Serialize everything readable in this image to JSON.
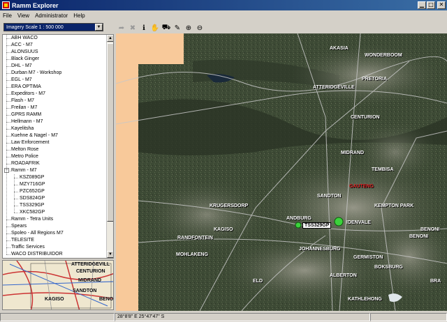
{
  "window": {
    "title": "Ramm Explorer"
  },
  "menu": [
    {
      "label": "File"
    },
    {
      "label": "View"
    },
    {
      "label": "Administrator"
    },
    {
      "label": "Help"
    }
  ],
  "scale_select": {
    "value": "Imagery Scale 1 : 500 000"
  },
  "toolbar": [
    {
      "name": "back-arrow-icon",
      "glyph": "➦",
      "disabled": true
    },
    {
      "name": "delete-icon",
      "glyph": "✖",
      "disabled": true
    },
    {
      "name": "info-icon",
      "glyph": "ℹ",
      "disabled": false
    },
    {
      "name": "pan-hand-icon",
      "glyph": "✋",
      "disabled": false
    },
    {
      "name": "vehicle-locate-icon",
      "glyph": "⛟",
      "disabled": false
    },
    {
      "name": "measure-icon",
      "glyph": "✎",
      "disabled": false
    },
    {
      "name": "zoom-in-icon",
      "glyph": "⊕",
      "disabled": false
    },
    {
      "name": "zoom-out-icon",
      "glyph": "⊖",
      "disabled": false
    }
  ],
  "tree": [
    {
      "label": "ABH WACO",
      "level": 0
    },
    {
      "label": "ACC - M7",
      "level": 0
    },
    {
      "label": "ALONSUUS",
      "level": 0
    },
    {
      "label": "Black Ginger",
      "level": 0
    },
    {
      "label": "DHL - M7",
      "level": 0
    },
    {
      "label": "Durban M7 - Workshop",
      "level": 0
    },
    {
      "label": "EGL - M7",
      "level": 0
    },
    {
      "label": "ERA OPTIMA",
      "level": 0
    },
    {
      "label": "Expeditors - M7",
      "level": 0
    },
    {
      "label": "Flash - M7",
      "level": 0
    },
    {
      "label": "Freilan - M7",
      "level": 0
    },
    {
      "label": "GPRS RAMM",
      "level": 0
    },
    {
      "label": "Hellmann - M7",
      "level": 0
    },
    {
      "label": "Kayelitsha",
      "level": 0
    },
    {
      "label": "Kuehne & Nagel - M7",
      "level": 0
    },
    {
      "label": "Law Enforcement",
      "level": 0
    },
    {
      "label": "Melton Rose",
      "level": 0
    },
    {
      "label": "Metro Police",
      "level": 0
    },
    {
      "label": "ROADAFRIK",
      "level": 0
    },
    {
      "label": "Ramm - M7",
      "level": 0,
      "expanded": true
    },
    {
      "label": "KSZ089GP",
      "level": 1
    },
    {
      "label": "MZY716GP",
      "level": 1
    },
    {
      "label": "PZC652GP",
      "level": 1
    },
    {
      "label": "SDS824GP",
      "level": 1
    },
    {
      "label": "TSS329GP",
      "level": 1
    },
    {
      "label": "XKC582GP",
      "level": 1
    },
    {
      "label": "Ramm - Tetra Units",
      "level": 0
    },
    {
      "label": "Spears",
      "level": 0
    },
    {
      "label": "Spoleo - All Regions M7",
      "level": 0
    },
    {
      "label": "TELESITE",
      "level": 0
    },
    {
      "label": "Traffic Services",
      "level": 0
    },
    {
      "label": "WACO DISTRIBUIDOR",
      "level": 0
    }
  ],
  "overview_labels": [
    {
      "text": "ATTERIDGEVILL"
    },
    {
      "text": "CENTURION"
    },
    {
      "text": "MIDRAND"
    },
    {
      "text": "SANDTON"
    },
    {
      "text": "KAGISO"
    },
    {
      "text": "BENO"
    }
  ],
  "map_labels": [
    {
      "text": "AKASIA",
      "red": false
    },
    {
      "text": "WONDERBOOM",
      "red": false
    },
    {
      "text": "PRETORIA",
      "red": false
    },
    {
      "text": "ATTERIDGEVILLE",
      "red": false
    },
    {
      "text": "CENTURION",
      "red": false
    },
    {
      "text": "MIDRAND",
      "red": false
    },
    {
      "text": "TEMBISA",
      "red": false
    },
    {
      "text": "SANDTON",
      "red": false
    },
    {
      "text": "KEMPTON PARK",
      "red": false
    },
    {
      "text": "KRUGERSDORP",
      "red": false
    },
    {
      "text": "KAGISO",
      "red": false
    },
    {
      "text": "RANDFONTEIN",
      "red": false
    },
    {
      "text": "MOHLAKENG",
      "red": false
    },
    {
      "text": "JOHANNESBURG",
      "red": false
    },
    {
      "text": "GERMISTON",
      "red": false
    },
    {
      "text": "BOKSBURG",
      "red": false
    },
    {
      "text": "BENONI",
      "red": false
    },
    {
      "text": "BENONI",
      "red": false
    },
    {
      "text": "ALBERTON",
      "red": false
    },
    {
      "text": "KATHLEHONG",
      "red": false
    },
    {
      "text": "ELD",
      "red": false
    },
    {
      "text": "BRA",
      "red": false
    },
    {
      "text": "ANDBURG",
      "red": false
    },
    {
      "text": "IDENVALE",
      "red": false
    },
    {
      "text": "GAUTENG",
      "red": true
    }
  ],
  "vehicles": [
    {
      "tag": "TSS329GP"
    }
  ],
  "status": {
    "coords": "28°8'8\" E   25°47'47\" S"
  },
  "colors": {
    "title_bar": "#0a246a",
    "selection": "#0a246a",
    "vehicle_marker": "#3cd23c"
  }
}
